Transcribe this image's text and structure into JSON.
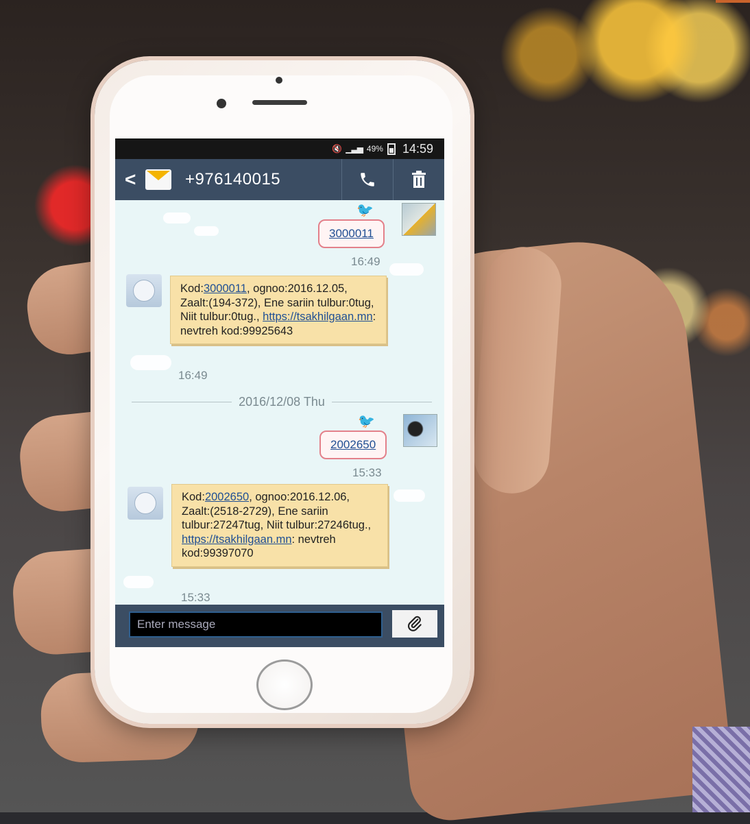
{
  "status_bar": {
    "battery": "49%",
    "time": "14:59"
  },
  "header": {
    "contact_number": "+976140015"
  },
  "messages": [
    {
      "type": "outgoing",
      "text": "3000011",
      "time": "16:49"
    },
    {
      "type": "incoming",
      "parts": {
        "p1": "Kod:",
        "link_code": "3000011",
        "p2": ", ognoo:2016.12.05, Zaalt:(194-372), Ene sariin tulbur:0tug, Niit tulbur:0tug., ",
        "link_url": "https://tsakhilgaan.mn",
        "p3": ": nevtreh kod:99925643"
      },
      "time": "16:49"
    },
    {
      "type": "date_separator",
      "text": "2016/12/08 Thu"
    },
    {
      "type": "outgoing",
      "text": "2002650",
      "time": "15:33"
    },
    {
      "type": "incoming",
      "parts": {
        "p1": "Kod:",
        "link_code": "2002650",
        "p2": ", ognoo:2016.12.06, Zaalt:(2518-2729), Ene sariin tulbur:27247tug, Niit tulbur:27246tug., ",
        "link_url": "https://tsakhilgaan.mn",
        "p3": ": nevtreh kod:99397070"
      },
      "time": "15:33"
    }
  ],
  "composer": {
    "placeholder": "Enter message"
  },
  "icons": {
    "back": "chevron-left-icon",
    "contact": "envelope-icon",
    "call": "phone-icon",
    "delete": "trash-icon",
    "attach": "paperclip-icon"
  },
  "colors": {
    "app_bar": "#3b4d63",
    "incoming_bubble": "#f8e1a8",
    "outgoing_border": "#e3808a",
    "chat_background": "#e9f6f7",
    "link": "#1f4f94"
  }
}
